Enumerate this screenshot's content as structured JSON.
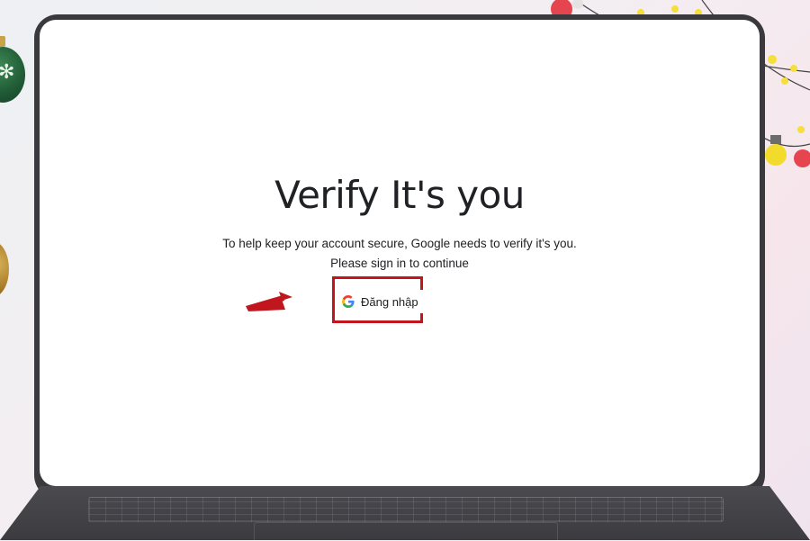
{
  "page": {
    "title": "Verify It's you",
    "description_line1": "To help keep your account secure, Google needs to verify it's you.",
    "description_line2": "Please sign in to continue",
    "signin_button": {
      "label": "Đăng nhập",
      "icon": "google-g-icon"
    }
  },
  "annotation": {
    "arrow_color": "#c2161f",
    "box_color": "#c2161f"
  },
  "colors": {
    "laptop_frame": "#3a3a3e",
    "screen_bg": "#ffffff",
    "text": "#202124"
  }
}
